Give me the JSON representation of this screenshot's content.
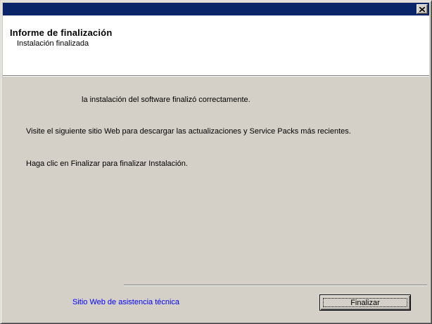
{
  "titlebar": {
    "title": "",
    "close_icon": "close-icon",
    "colors": {
      "titlebar": "#0a246a"
    }
  },
  "header": {
    "title": "Informe de finalización",
    "subtitle": "Instalación finalizada"
  },
  "content": {
    "success_message": "la instalación del software finalizó correctamente.",
    "updates_message": "Visite el siguiente sitio Web para descargar las actualizaciones y Service Packs más recientes.",
    "finish_instruction": "Haga clic en Finalizar para finalizar Instalación."
  },
  "footer": {
    "support_link": "Sitio Web de asistencia técnica",
    "finish_button": "Finalizar",
    "colors": {
      "link": "#0000ff",
      "dialog_bg": "#d4d0c8"
    }
  }
}
